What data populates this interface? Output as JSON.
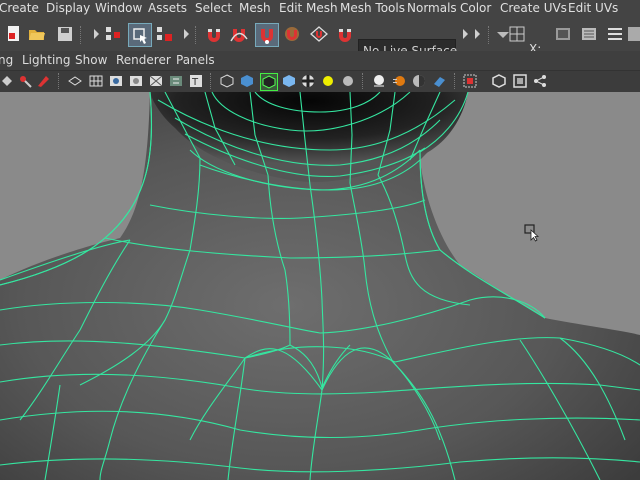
{
  "menu": {
    "items": [
      "Create",
      "Display",
      "Window",
      "Assets",
      "Select",
      "Mesh",
      "Edit Mesh",
      "Mesh Tools",
      "Normals",
      "Color",
      "Create UVs",
      "Edit UVs"
    ]
  },
  "status_line": {
    "live_surface": "No Live Surface",
    "axis_label": "X:"
  },
  "panel_menu": {
    "items": [
      "ng",
      "Lighting",
      "Show",
      "Renderer",
      "Panels"
    ]
  },
  "colors": {
    "wire": "#35e6a0",
    "background": "#8a8a8a",
    "ui": "#444444"
  }
}
